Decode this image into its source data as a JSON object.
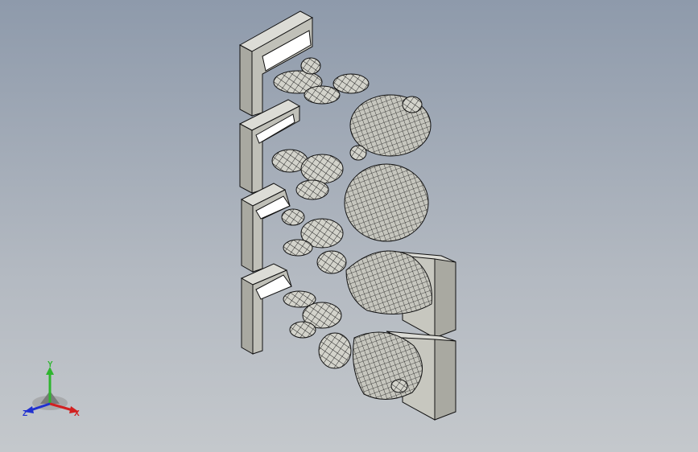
{
  "viewport": {
    "background_top": "#8e9aab",
    "background_bottom": "#c4c8cc",
    "model_fill": "#c9c9c1",
    "model_shadow": "#9b9b93",
    "mesh_color": "#1a1a1a"
  },
  "triad": {
    "x_label": "X",
    "y_label": "Y",
    "z_label": "Z",
    "x_color": "#d22020",
    "y_color": "#2fb52f",
    "z_color": "#2030d0"
  }
}
